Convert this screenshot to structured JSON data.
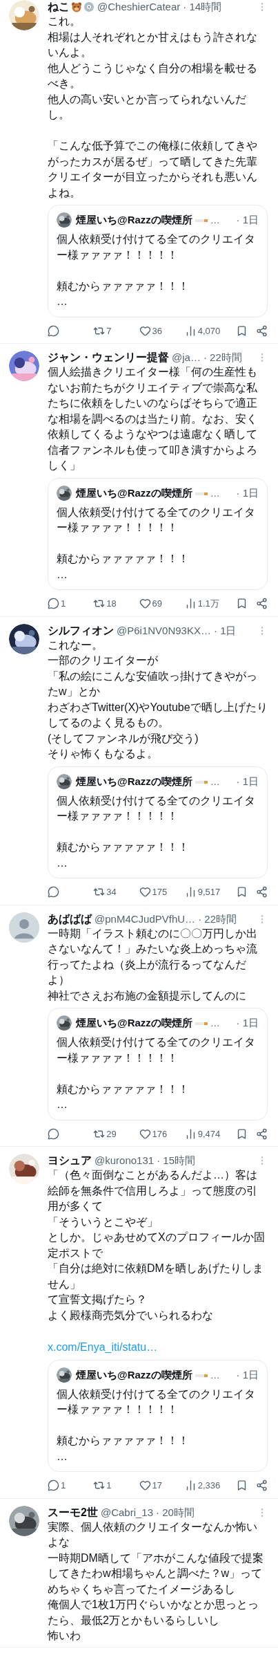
{
  "tweets": [
    {
      "author": {
        "name": "ねこ",
        "handle": "@CheshierCatear",
        "time": "· 14時間",
        "name_emoji": true
      },
      "body": [
        [
          "これ。",
          "相場は人それぞれとか甘えはもう許されないんよ。",
          "他人どうこうじゃなく自分の相場を載せるべき。",
          "他人の高い安いとか言ってられないんだし。"
        ],
        [
          "「こんな低予算でこの俺様に依頼してきやがったカスが居るぜ」って晒してきた先輩クリエイターが目立ったからそれも悪いんよね。"
        ]
      ],
      "quote": {
        "name": "煙屋いち@Razzの喫煙所",
        "has_emoji": true,
        "more": "…",
        "time": "· 1日",
        "body": [
          [
            "個人依頼受け付けてる全てのクリエイター様ァァァァ！！！！！"
          ],
          [
            "頼むからァァァァァ！！！",
            "…"
          ]
        ]
      },
      "actions": {
        "reposts": "7",
        "likes": "36",
        "views": "4,070"
      }
    },
    {
      "author": {
        "name": "ジャン・ウェンリー提督",
        "handle": "@ja…",
        "time": "· 22時間"
      },
      "body": [
        [
          "個人絵描きクリエイター様「何の生産性もないお前たちがクリエイティブで崇高な私たちに依頼をしたいのならばそちらで適正な相場を調べるのは当たり前。なお、安く依頼してくるようなやつは遠慮なく晒して信者ファンネルも使って叩き潰すからよろしく」"
        ]
      ],
      "quote": {
        "name": "煙屋いち@Razzの喫煙所",
        "has_emoji": true,
        "more": "…",
        "time": "· 1日",
        "body": [
          [
            "個人依頼受け付けてる全てのクリエイター様ァァァァ！！！！！"
          ],
          [
            "頼むからァァァァァ！！！",
            "…"
          ]
        ]
      },
      "actions": {
        "replies": "1",
        "reposts": "18",
        "likes": "69",
        "views": "1.1万"
      }
    },
    {
      "author": {
        "name": "シルフィオン",
        "handle": "@P6i1NV0N93KX…",
        "time": "· 1日"
      },
      "body": [
        [
          "これなー。",
          "一部のクリエイターが",
          "「私の絵にこんな安値吹っ掛けてきやがったw」とか",
          "わざわざTwitter(X)やYoutubeで晒し上げたりしてるのよく見るもの。",
          "(そしてファンネルが飛び交う)",
          "そりゃ怖くもなるよ。"
        ]
      ],
      "quote": {
        "name": "煙屋いち@Razzの喫煙所",
        "has_emoji": true,
        "more": "…",
        "time": "· 1日",
        "body": [
          [
            "個人依頼受け付けてる全てのクリエイター様ァァァァ！！！！！"
          ],
          [
            "頼むからァァァァァ！！！",
            "…"
          ]
        ]
      },
      "actions": {
        "reposts": "34",
        "likes": "175",
        "views": "9,517"
      }
    },
    {
      "author": {
        "name": "あばばば",
        "handle": "@pnM4CJudPVfhU…",
        "time": "· 22時間"
      },
      "body": [
        [
          "一時期「イラスト頼むのに〇〇万円しか出さないなんて！」みたいな炎上めっちゃ流行ってたよね（炎上が流行るってなんだよ）",
          "神社でさえお布施の金額提示してんのに"
        ]
      ],
      "quote": {
        "name": "煙屋いち@Razzの喫煙所",
        "has_emoji": true,
        "more": "…",
        "time": "· 1日",
        "body": [
          [
            "個人依頼受け付けてる全てのクリエイター様ァァァァ！！！！！"
          ],
          [
            "頼むからァァァァァ！！！",
            "…"
          ]
        ]
      },
      "actions": {
        "reposts": "29",
        "likes": "176",
        "views": "9,474"
      }
    },
    {
      "author": {
        "name": "ヨシュア",
        "handle": "@kurono131",
        "time": "· 15時間"
      },
      "body": [
        [
          "「（色々面倒なことがあるんだよ…）客は絵師を無条件で信用しろよ」って態度の引用が多くて",
          "「そういうとこやぞ」",
          "としか。じゃあせめてXのプロフィールか固定ポストで",
          "「自分は絶対に依頼DMを晒しあげたりしません」",
          "て宣誓文掲げたら？",
          "よく殿様商売気分でいられるわな"
        ]
      ],
      "link": "x.com/Enya_iti/statu…",
      "quote": {
        "name": "煙屋いち@Razzの喫煙所",
        "has_emoji": true,
        "more": "…",
        "time": "· 1日",
        "body": [
          [
            "個人依頼受け付けてる全てのクリエイター様ァァァァ！！！！！"
          ],
          [
            "頼むからァァァァァ！！！",
            "…"
          ]
        ]
      },
      "actions": {
        "replies": "1",
        "reposts": "1",
        "likes": "17",
        "views": "2,336"
      }
    },
    {
      "author": {
        "name": "スーモ2世",
        "handle": "@Cabri_13",
        "time": "· 20時間"
      },
      "body": [
        [
          "実際、個人依頼のクリエイターなんか怖いよな",
          "一時期DM晒して「アホがこんな値段で提案してきたわw相場ちゃんと調べた？w」ってめちゃくちゃ言ってたイメージあるし",
          "俺個人で1枚1万円ぐらいかなとか思っとったら、最低2万とかもいるらしいし",
          "怖いわ"
        ]
      ]
    }
  ]
}
